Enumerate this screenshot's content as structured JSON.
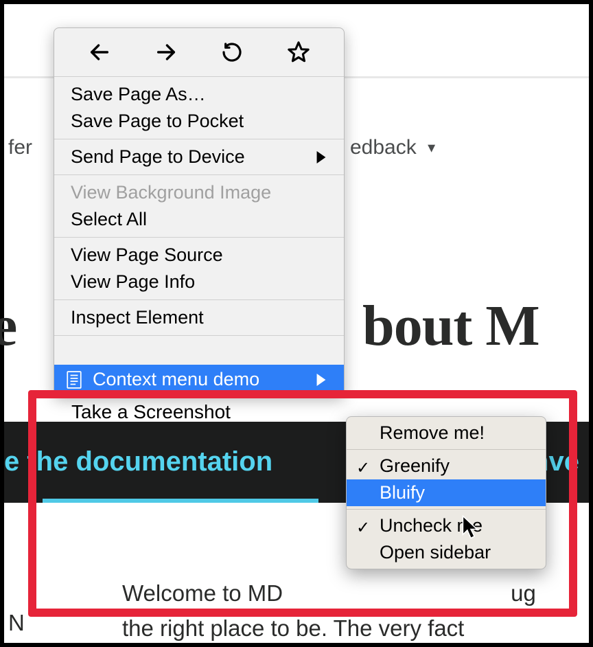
{
  "nav": {
    "left_fragment": "fer",
    "feedback": "edback",
    "caret": "▾"
  },
  "heading": {
    "left": "e",
    "right": "bout M"
  },
  "band": {
    "doc_link_left": "e the documentation",
    "doc_link_right": "nve"
  },
  "body_text": {
    "line1": "Welcome to MD",
    "line1b": "ug",
    "line2": "the right place to be. The very fact",
    "n": "N"
  },
  "screenshot_fragment": "Take a Screenshot",
  "context_menu": {
    "save_page_as": "Save Page As…",
    "save_to_pocket": "Save Page to Pocket",
    "send_to_device": "Send Page to Device",
    "view_bg_image": "View Background Image",
    "select_all": "Select All",
    "view_source": "View Page Source",
    "view_info": "View Page Info",
    "inspect": "Inspect Element",
    "demo": "Context menu demo"
  },
  "submenu": {
    "remove": "Remove me!",
    "greenify": "Greenify",
    "bluify": "Bluify",
    "uncheck": "Uncheck me",
    "open_sidebar": "Open sidebar"
  }
}
